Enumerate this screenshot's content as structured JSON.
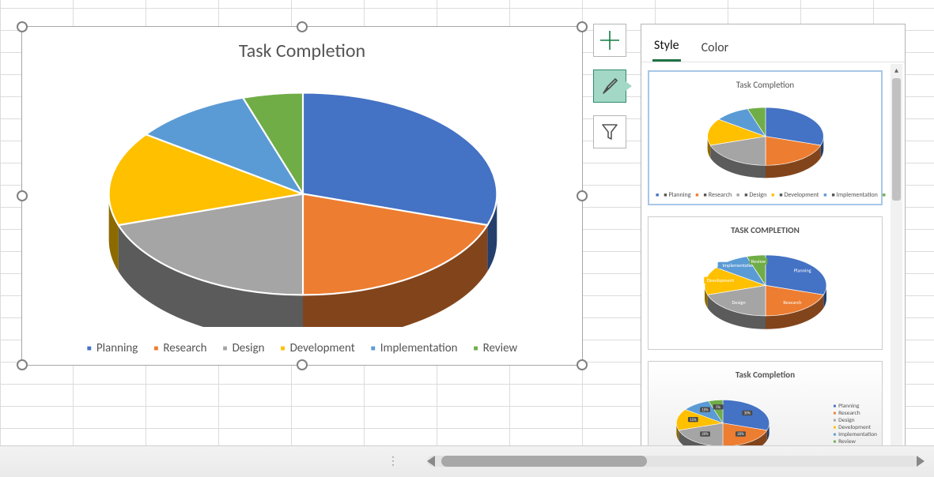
{
  "chart_data": {
    "type": "pie",
    "title": "Task Completion",
    "series": [
      {
        "name": "Planning",
        "value": 30,
        "color": "#4472C4"
      },
      {
        "name": "Research",
        "value": 20,
        "color": "#ED7D31"
      },
      {
        "name": "Design",
        "value": 20,
        "color": "#A5A5A5"
      },
      {
        "name": "Development",
        "value": 15,
        "color": "#FFC000"
      },
      {
        "name": "Implementation",
        "value": 10,
        "color": "#5B9BD5"
      },
      {
        "name": "Review",
        "value": 5,
        "color": "#70AD47"
      }
    ],
    "legend_position": "bottom"
  },
  "format_buttons": {
    "add_element": {
      "icon": "plus",
      "active": false
    },
    "chart_styles": {
      "icon": "brush",
      "active": true
    },
    "chart_filter": {
      "icon": "funnel",
      "active": false
    }
  },
  "panel": {
    "tabs": {
      "style": "Style",
      "color": "Color",
      "active": "style"
    },
    "styles": [
      {
        "title": "Task Completion",
        "variant": "3d-bottom-legend",
        "selected": true
      },
      {
        "title": "TASK COMPLETION",
        "variant": "3d-callout-labels",
        "selected": false
      },
      {
        "title": "Task Completion",
        "variant": "3d-percent-right-legend",
        "selected": false,
        "percents": [
          "30%",
          "20%",
          "20%",
          "15%",
          "10%",
          "5%"
        ]
      }
    ]
  }
}
